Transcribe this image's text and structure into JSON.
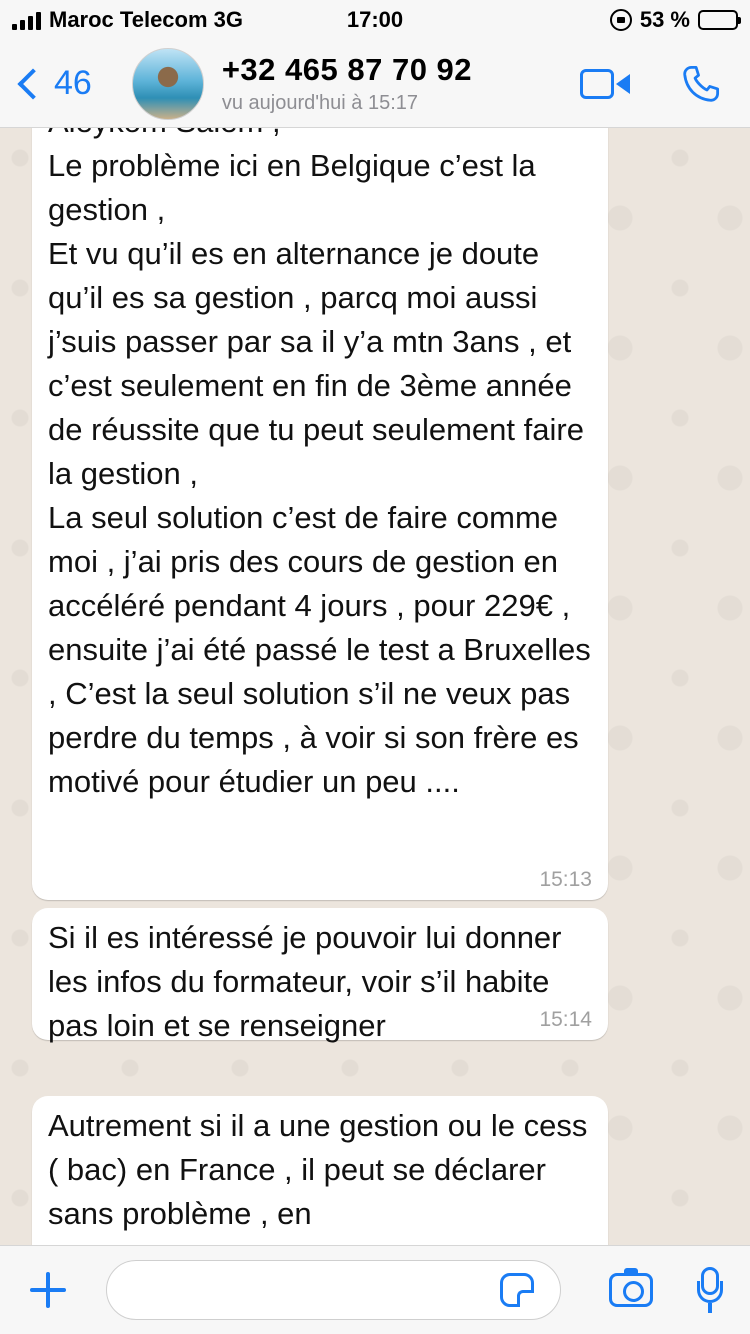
{
  "status_bar": {
    "carrier": "Maroc Telecom 3G",
    "time": "17:00",
    "battery_percent": "53 %",
    "battery_level": 0.53
  },
  "header": {
    "back_count": "46",
    "contact_name": "+32 465 87 70 92",
    "last_seen": "vu aujourd'hui à 15:17"
  },
  "messages": [
    {
      "text": "Aleykom Salem ,\nLe problème ici en Belgique c’est la gestion ,\nEt vu qu’il es en alternance je doute qu’il es sa gestion , parcq moi aussi j’suis passer par sa il y’a mtn 3ans , et c’est seulement en fin de 3ème année de réussite que tu peut seulement faire la gestion ,\nLa seul solution c’est de faire comme moi , j’ai pris des cours de gestion en accéléré pendant 4 jours , pour 229€ , ensuite j’ai été passé le test a Bruxelles , C’est la seul solution s’il ne veux pas perdre du temps , à voir si son frère es motivé pour étudier un peu ....",
      "time": "15:13"
    },
    {
      "text": "Si il es intéressé je pouvoir lui donner les infos du formateur, voir s’il habite pas loin et se renseigner",
      "time": "15:14"
    },
    {
      "text": "Autrement si il a une gestion ou le cess ( bac) en France , il peut se déclarer sans problème , en",
      "time": ""
    }
  ],
  "input": {
    "value": "",
    "placeholder": ""
  },
  "colors": {
    "accent": "#1a7cf4",
    "chat_background": "#ece5dd",
    "bubble": "#ffffff",
    "battery": "#f7c600"
  }
}
